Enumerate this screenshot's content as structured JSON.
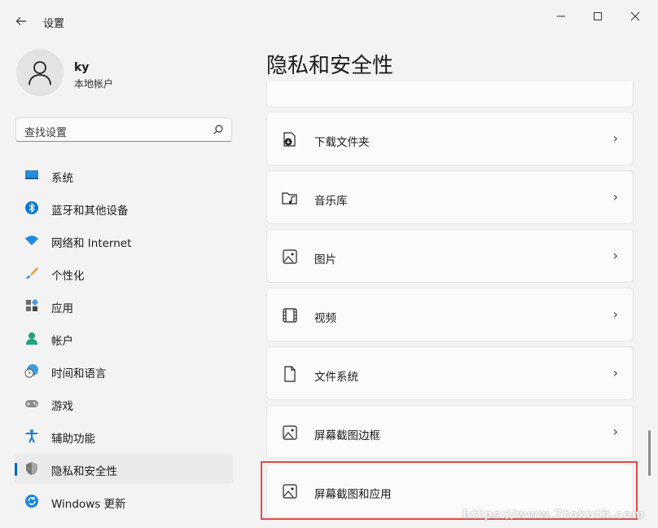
{
  "titlebar": {
    "title": "设置",
    "back_icon": "arrow-left-icon",
    "minimize_icon": "minimize-icon",
    "maximize_icon": "maximize-icon",
    "close_icon": "close-icon"
  },
  "user": {
    "name": "ky",
    "account_type": "本地帐户",
    "avatar_icon": "person-icon"
  },
  "search": {
    "placeholder": "查找设置",
    "icon": "search-icon"
  },
  "nav": {
    "items": [
      {
        "label": "系统",
        "icon": "monitor-icon",
        "active": false
      },
      {
        "label": "蓝牙和其他设备",
        "icon": "bluetooth-icon",
        "active": false
      },
      {
        "label": "网络和 Internet",
        "icon": "wifi-icon",
        "active": false
      },
      {
        "label": "个性化",
        "icon": "brush-icon",
        "active": false
      },
      {
        "label": "应用",
        "icon": "apps-icon",
        "active": false
      },
      {
        "label": "帐户",
        "icon": "account-icon",
        "active": false
      },
      {
        "label": "时间和语言",
        "icon": "clock-globe-icon",
        "active": false
      },
      {
        "label": "游戏",
        "icon": "gamepad-icon",
        "active": false
      },
      {
        "label": "辅助功能",
        "icon": "accessibility-icon",
        "active": false
      },
      {
        "label": "隐私和安全性",
        "icon": "shield-icon",
        "active": true
      },
      {
        "label": "Windows 更新",
        "icon": "update-icon",
        "active": false
      }
    ]
  },
  "main": {
    "title": "隐私和安全性",
    "cards": [
      {
        "label": "下载文件夹",
        "icon": "download-folder-icon"
      },
      {
        "label": "音乐库",
        "icon": "music-folder-icon"
      },
      {
        "label": "图片",
        "icon": "image-icon"
      },
      {
        "label": "视频",
        "icon": "film-icon"
      },
      {
        "label": "文件系统",
        "icon": "file-icon"
      },
      {
        "label": "屏幕截图边框",
        "icon": "screenshot-border-icon"
      },
      {
        "label": "屏幕截图和应用",
        "icon": "screenshot-apps-icon"
      }
    ]
  },
  "watermark": "https://www.7tokuth.com",
  "colors": {
    "accent": "#0067c0",
    "highlight_border": "#e24a4a",
    "background": "#f3f3f3",
    "card": "#fbfbfb"
  }
}
